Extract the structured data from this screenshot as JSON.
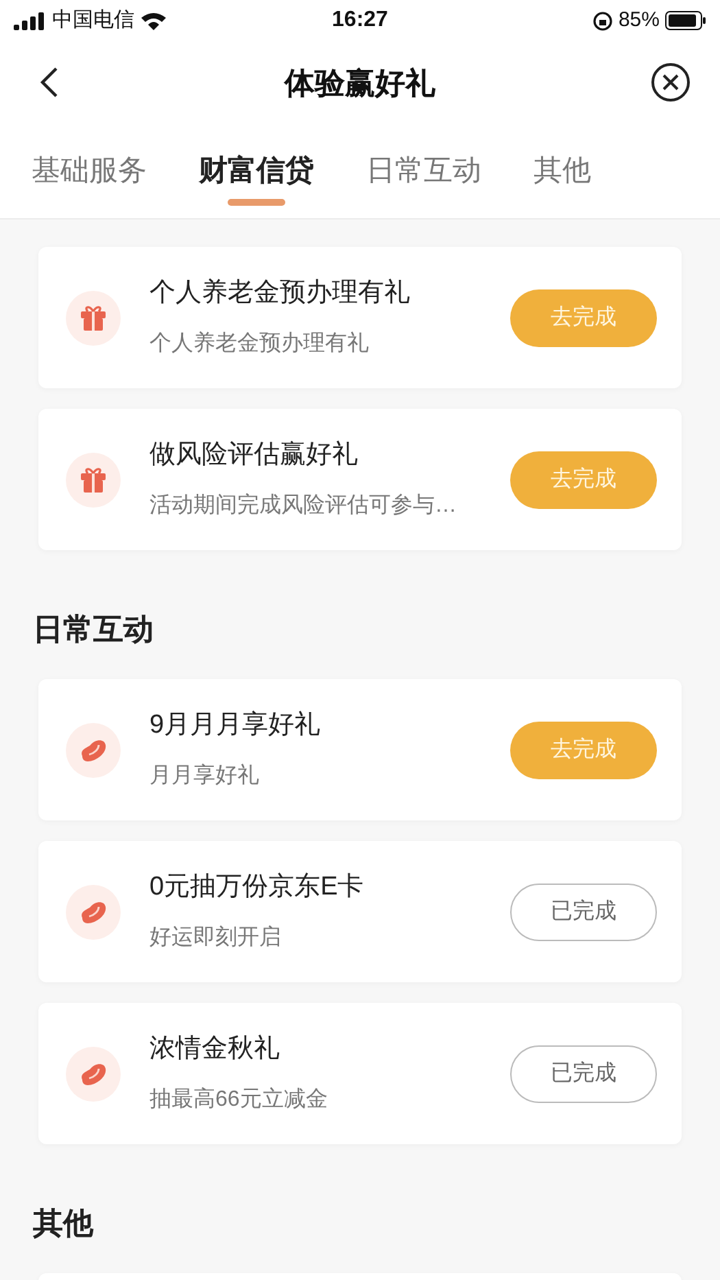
{
  "status_bar": {
    "carrier": "中国电信",
    "time": "16:27",
    "battery": "85%"
  },
  "nav": {
    "title": "体验赢好礼"
  },
  "tabs": [
    {
      "label": "基础服务",
      "selected": false
    },
    {
      "label": "财富信贷",
      "selected": true
    },
    {
      "label": "日常互动",
      "selected": false
    },
    {
      "label": "其他",
      "selected": false
    }
  ],
  "sections": [
    {
      "tasks": [
        {
          "kind": "gift",
          "title": "个人养老金预办理有礼",
          "subtitle": "个人养老金预办理有礼",
          "button": "去完成",
          "completed": false
        },
        {
          "kind": "gift",
          "title": "做风险评估赢好礼",
          "subtitle": "活动期间完成风险评估可参与…",
          "button": "去完成",
          "completed": false
        }
      ]
    },
    {
      "title": "日常互动",
      "tasks": [
        {
          "kind": "bean",
          "title": "9月月月享好礼",
          "subtitle": "月月享好礼",
          "button": "去完成",
          "completed": false
        },
        {
          "kind": "bean",
          "title": "0元抽万份京东E卡",
          "subtitle": "好运即刻开启",
          "button": "已完成",
          "completed": true
        },
        {
          "kind": "bean",
          "title": "浓情金秋礼",
          "subtitle": "抽最高66元立减金",
          "button": "已完成",
          "completed": true
        }
      ]
    },
    {
      "title": "其他",
      "partial_card": true
    }
  ]
}
